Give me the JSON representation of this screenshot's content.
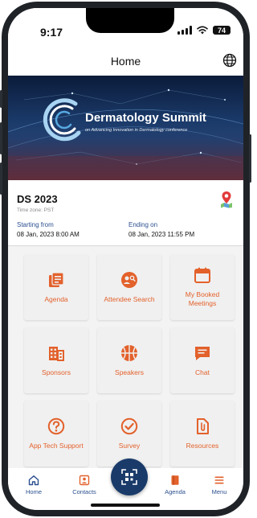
{
  "status_bar": {
    "time": "9:17",
    "battery": "74"
  },
  "header": {
    "title": "Home",
    "globe_icon": "globe-icon"
  },
  "banner": {
    "title": "Dermatology Summit",
    "subtitle": "on Advancing Innovation in Dermatology conference"
  },
  "event": {
    "name": "DS 2023",
    "timezone": "Time zone: PST",
    "start_label": "Starting from",
    "start_value": "08 Jan, 2023  8:00 AM",
    "end_label": "Ending on",
    "end_value": "08 Jan, 2023  11:55 PM"
  },
  "tiles": [
    {
      "label": "Agenda",
      "icon": "agenda-icon"
    },
    {
      "label": "Attendee Search",
      "icon": "attendee-search-icon"
    },
    {
      "label": "My Booked Meetings",
      "icon": "calendar-icon"
    },
    {
      "label": "Sponsors",
      "icon": "building-icon"
    },
    {
      "label": "Speakers",
      "icon": "basketball-icon"
    },
    {
      "label": "Chat",
      "icon": "chat-icon"
    },
    {
      "label": "App Tech Support",
      "icon": "question-icon"
    },
    {
      "label": "Survey",
      "icon": "check-circle-icon"
    },
    {
      "label": "Resources",
      "icon": "document-icon"
    }
  ],
  "bottom_nav": [
    {
      "label": "Home",
      "icon": "home-icon"
    },
    {
      "label": "Contacts",
      "icon": "contacts-icon"
    },
    {
      "label": "",
      "icon": "qr-scan-icon"
    },
    {
      "label": "Agenda",
      "icon": "book-icon"
    },
    {
      "label": "Menu",
      "icon": "menu-icon"
    }
  ],
  "colors": {
    "accent": "#e3612b",
    "nav": "#2b4f8f",
    "scan": "#1a3b6a"
  }
}
